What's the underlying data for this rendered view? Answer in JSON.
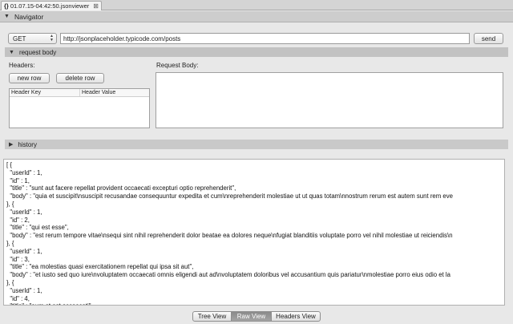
{
  "tab": {
    "icon": "json-braces-icon",
    "icon_glyph": "{}",
    "title": "01.07.15-04:42:50.jsonviewer",
    "close": "⊠"
  },
  "navigator": {
    "label": "Navigator"
  },
  "request": {
    "method": "GET",
    "url": "http://jsonplaceholder.typicode.com/posts",
    "send_label": "send",
    "section_label": "request body",
    "headers_label": "Headers:",
    "new_row_label": "new row",
    "delete_row_label": "delete row",
    "table_columns": [
      "Header Key",
      "Header Value"
    ],
    "body_label": "Request Body:"
  },
  "history": {
    "label": "history"
  },
  "raw_output": [
    "[ {",
    "  \"userId\" : 1,",
    "  \"id\" : 1,",
    "  \"title\" : \"sunt aut facere repellat provident occaecati excepturi optio reprehenderit\",",
    "  \"body\" : \"quia et suscipit\\nsuscipit recusandae consequuntur expedita et cum\\nreprehenderit molestiae ut ut quas totam\\nnostrum rerum est autem sunt rem eve",
    "}, {",
    "  \"userId\" : 1,",
    "  \"id\" : 2,",
    "  \"title\" : \"qui est esse\",",
    "  \"body\" : \"est rerum tempore vitae\\nsequi sint nihil reprehenderit dolor beatae ea dolores neque\\nfugiat blanditiis voluptate porro vel nihil molestiae ut reiciendis\\n",
    "}, {",
    "  \"userId\" : 1,",
    "  \"id\" : 3,",
    "  \"title\" : \"ea molestias quasi exercitationem repellat qui ipsa sit aut\",",
    "  \"body\" : \"et iusto sed quo iure\\nvoluptatem occaecati omnis eligendi aut ad\\nvoluptatem doloribus vel accusantium quis pariatur\\nmolestiae porro eius odio et la",
    "}, {",
    "  \"userId\" : 1,",
    "  \"id\" : 4,",
    "  \"title\" : \"eum et est occaecati\","
  ],
  "views": {
    "tree": "Tree View",
    "raw": "Raw View",
    "headers": "Headers View",
    "selected": "Raw View"
  }
}
